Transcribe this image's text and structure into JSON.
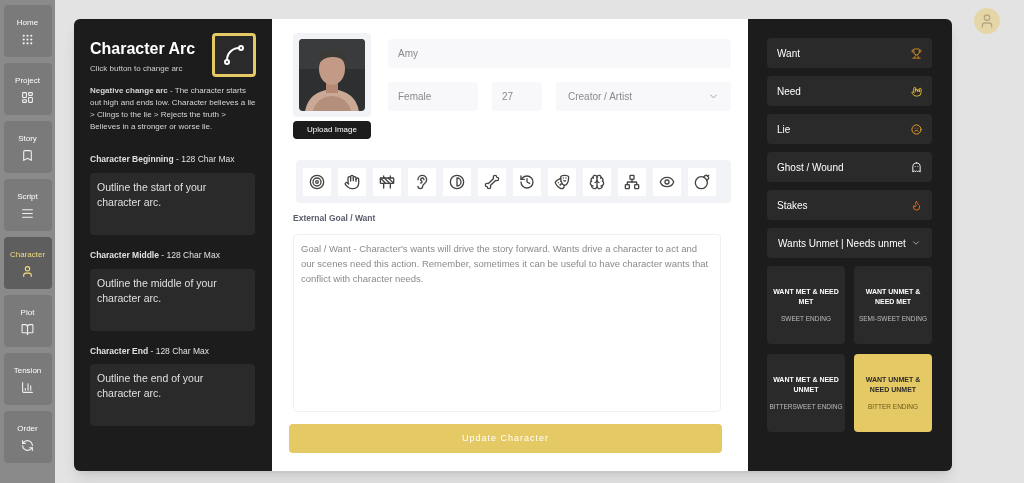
{
  "sidebar": [
    {
      "label": "Home",
      "selected": false
    },
    {
      "label": "Project",
      "selected": false
    },
    {
      "label": "Story",
      "selected": false
    },
    {
      "label": "Script",
      "selected": false
    },
    {
      "label": "Character",
      "selected": true
    },
    {
      "label": "Plot",
      "selected": false
    },
    {
      "label": "Tension",
      "selected": false
    },
    {
      "label": "Order",
      "selected": false
    }
  ],
  "arc_panel": {
    "title": "Character Arc",
    "subtitle": "Click button to change arc",
    "description": "**Negative change arc** - The character starts out high and ends low. Character believes a lie > Clings to the lie > Rejects the truth > Believes in a stronger or worse lie.",
    "sections": [
      {
        "label": "**Character Beginning** - 128 Char Max",
        "placeholder": "Outline the start of your character arc."
      },
      {
        "label": "**Character Middle** - 128 Char Max",
        "placeholder": "Outline the middle of your character arc."
      },
      {
        "label": "**Character End** - 128 Char Max",
        "placeholder": "Outline the end of your character arc."
      }
    ]
  },
  "profile": {
    "upload_button": "Upload Image",
    "name_placeholder": "Amy",
    "gender_placeholder": "Female",
    "age_placeholder": "27",
    "role": "Creator / Artist"
  },
  "goal": {
    "label": "External Goal / Want",
    "placeholder": "Goal / Want - Character's wants will drive the story forward. Wants drive a character to act and our scenes need this action. Remember, sometimes it can be useful to have character wants that conflict with character needs."
  },
  "update_button": "Update Character",
  "traits": [
    {
      "label": "Want",
      "kind": "trophy"
    },
    {
      "label": "Need",
      "kind": "fingers"
    },
    {
      "label": "Lie",
      "kind": "face"
    },
    {
      "label": "Ghost / Wound",
      "kind": "ghost"
    },
    {
      "label": "Stakes",
      "kind": "fire"
    }
  ],
  "outcome_select": "Wants Unmet | Needs unmet",
  "endings": [
    {
      "title": "WANT MET & NEED MET",
      "subtitle": "SWEET ENDING",
      "selected": false
    },
    {
      "title": "WANT UNMET & NEED MET",
      "subtitle": "SEMI-SWEET ENDING",
      "selected": false
    },
    {
      "title": "WANT MET & NEED UNMET",
      "subtitle": "BITTERSWEET ENDING",
      "selected": false
    },
    {
      "title": "WANT UNMET & NEED UNMET",
      "subtitle": "BITTER ENDING",
      "selected": true
    }
  ]
}
